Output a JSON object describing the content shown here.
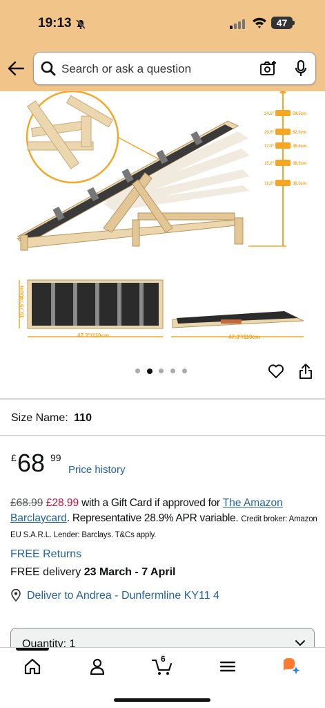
{
  "status_bar": {
    "time": "19:13",
    "battery": "47"
  },
  "search": {
    "placeholder": "Search or ask a question"
  },
  "gallery": {
    "heights": [
      "24.5\"",
      "20.5\"",
      "17.9\"",
      "15.2\"",
      "12.0\""
    ],
    "heights_cm": [
      "59.5cm",
      "52.0cm",
      "45.5cm",
      "38.5cm",
      "30.5cm"
    ],
    "dim_side": "15.75\"/40cm",
    "dim_length_top": "47.3\"/110cm",
    "dim_length_side": "47.3\"/110cm",
    "dots": 5,
    "active_dot": 1
  },
  "size": {
    "label": "Size Name:",
    "value": "110"
  },
  "price": {
    "symbol": "£",
    "whole": "68",
    "fraction": "99",
    "history_label": "Price history"
  },
  "gift": {
    "was": "£68.99",
    "now": "£28.99",
    "text1": " with a Gift Card if approved for ",
    "link": "The Amazon Barclaycard",
    "text2": ". Representative 28.9% APR variable. ",
    "small": "Credit broker: Amazon EU S.A.R.L. Lender: Barclays. T&Cs apply."
  },
  "delivery": {
    "returns": "FREE Returns",
    "free_delivery": "FREE delivery ",
    "dates": "23 March - 7 April",
    "deliver_to": "Deliver to Andrea - Dunfermline KY11 4"
  },
  "quantity": {
    "label": "Quantity: 1"
  },
  "nav": {
    "cart_count": "6"
  },
  "colors": {
    "header": "#f1c48a",
    "link": "#2162a1",
    "deal": "#cc0c39",
    "accent": "#f5a623"
  }
}
